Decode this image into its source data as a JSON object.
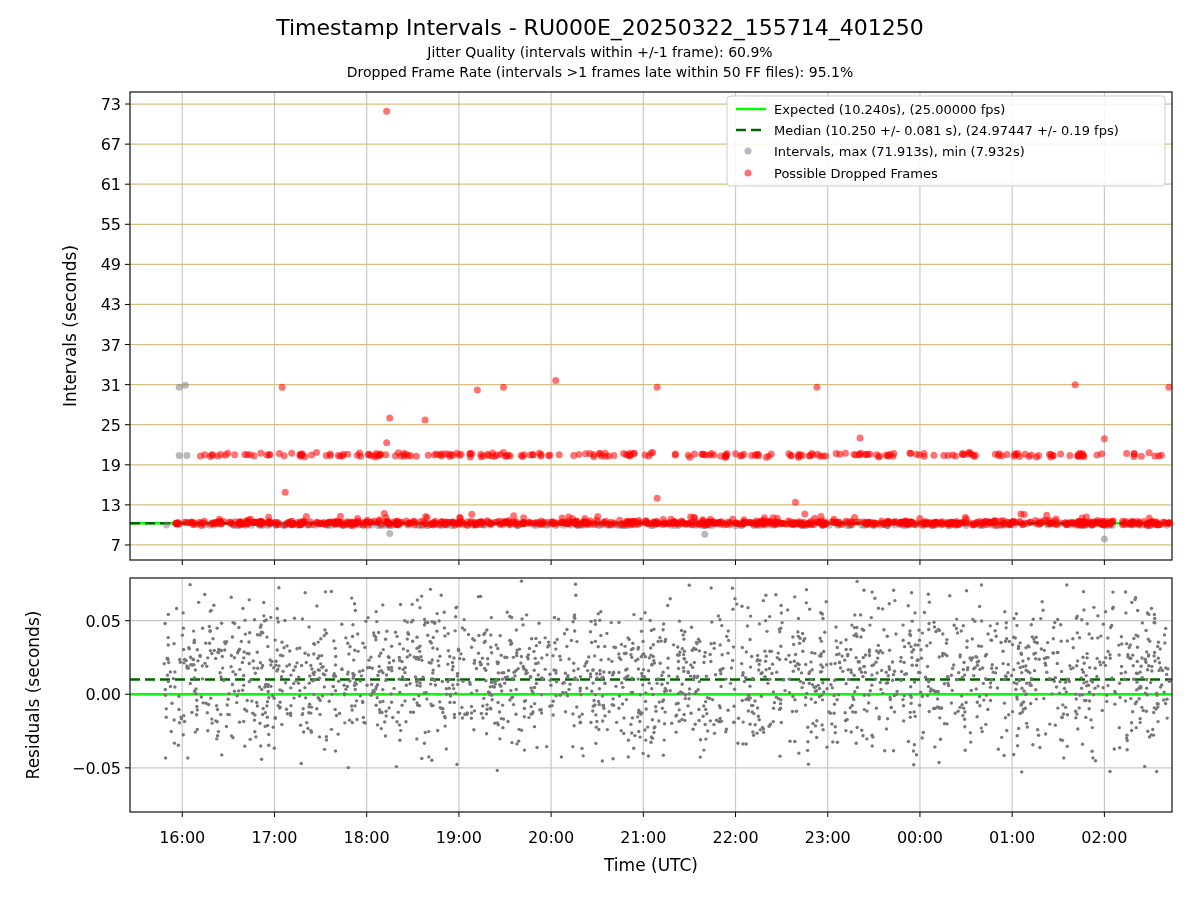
{
  "figure": {
    "title": "Timestamp Intervals - RU000E_20250322_155714_401250",
    "subtitles": [
      "Jitter Quality (intervals within +/-1 frame): 60.9%",
      "Dropped Frame Rate (intervals >1 frames late within 50 FF files): 95.1%"
    ]
  },
  "charts": [
    {
      "chart_data": {
        "type": "scatter",
        "ylabel": "Intervals (seconds)",
        "xlim": [
          "2025-03-22T15:26",
          "2025-03-23T02:44"
        ],
        "ylim": [
          4.75,
          74.8
        ],
        "yticks": [
          7,
          13,
          19,
          25,
          31,
          37,
          43,
          49,
          55,
          61,
          67,
          73
        ],
        "grid": true,
        "legend": true,
        "ref_lines": [
          {
            "axis": "y",
            "value": 10.24,
            "label": "Expected (10.240s), (25.00000 fps)",
            "color": "#00ff00"
          },
          {
            "axis": "y",
            "value": 10.25,
            "label": "Median (10.250 +/- 0.081 s), (24.97447 +/- 0.19 fps)",
            "color": "#006400"
          }
        ],
        "series": [
          {
            "name": "Intervals, max (71.913s), min (7.932s)",
            "color": "#808080",
            "x": [
              "2025-03-22T15:58",
              "2025-03-22T16:02",
              "2025-03-22T15:58",
              "2025-03-22T16:03",
              "2025-03-23T02:00",
              "2025-03-22T18:15",
              "2025-03-22T21:40"
            ],
            "values": [
              30.6,
              30.9,
              20.4,
              20.4,
              7.9,
              8.7,
              8.6
            ]
          },
          {
            "name": "Possible Dropped Frames",
            "color": "#ff0000",
            "x": [
              "2025-03-22T18:13",
              "2025-03-22T17:05",
              "2025-03-22T19:12",
              "2025-03-22T19:29",
              "2025-03-22T20:03",
              "2025-03-22T21:09",
              "2025-03-22T22:53",
              "2025-03-23T01:41",
              "2025-03-23T02:42",
              "2025-03-22T18:15",
              "2025-03-22T18:38",
              "2025-03-22T18:13",
              "2025-03-22T23:21",
              "2025-03-23T02:00",
              "2025-03-22T17:07",
              "2025-03-22T21:09",
              "2025-03-22T22:39"
            ],
            "values": [
              71.9,
              30.6,
              30.2,
              30.6,
              31.6,
              30.6,
              30.6,
              31.0,
              30.6,
              26.0,
              25.7,
              22.3,
              23.0,
              22.9,
              14.9,
              14.0,
              13.4
            ]
          }
        ]
      }
    },
    {
      "chart_data": {
        "type": "scatter",
        "xlabel": "Time (UTC)",
        "ylabel": "Residuals (seconds)",
        "xlim": [
          "2025-03-22T15:26",
          "2025-03-23T02:44"
        ],
        "ylim": [
          -0.08,
          0.079
        ],
        "xticks": [
          {
            "value": "2025-03-22T16:00",
            "label": "16:00"
          },
          {
            "value": "2025-03-22T17:00",
            "label": "17:00"
          },
          {
            "value": "2025-03-22T18:00",
            "label": "18:00"
          },
          {
            "value": "2025-03-22T19:00",
            "label": "19:00"
          },
          {
            "value": "2025-03-22T20:00",
            "label": "20:00"
          },
          {
            "value": "2025-03-22T21:00",
            "label": "21:00"
          },
          {
            "value": "2025-03-22T22:00",
            "label": "22:00"
          },
          {
            "value": "2025-03-22T23:00",
            "label": "23:00"
          },
          {
            "value": "2025-03-23T00:00",
            "label": "00:00"
          },
          {
            "value": "2025-03-23T01:00",
            "label": "01:00"
          },
          {
            "value": "2025-03-23T02:00",
            "label": "02:00"
          }
        ],
        "yticks": [
          {
            "value": 0.05,
            "label": "0.05"
          },
          {
            "value": 0,
            "label": "0.00"
          },
          {
            "value": -0.05,
            "label": "−0.05"
          }
        ],
        "grid": true,
        "ref_lines": [
          {
            "axis": "y",
            "value": 0,
            "color": "#00ff00"
          },
          {
            "axis": "y",
            "value": 0.01,
            "color": "#006400"
          }
        ]
      }
    }
  ]
}
